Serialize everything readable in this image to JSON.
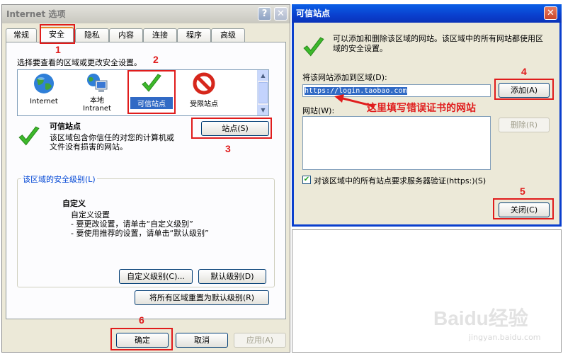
{
  "left_dialog": {
    "title": "Internet 选项",
    "tabs": [
      "常规",
      "安全",
      "隐私",
      "内容",
      "连接",
      "程序",
      "高级"
    ],
    "zone_prompt": "选择要查看的区域或更改安全设置。",
    "zones": [
      {
        "label": "Internet",
        "icon": "globe-icon"
      },
      {
        "label": "本地\nIntranet",
        "icon": "intranet-icon"
      },
      {
        "label": "可信站点",
        "icon": "checkmark-icon"
      },
      {
        "label": "受限站点",
        "icon": "no-entry-icon"
      }
    ],
    "zone_title": "可信站点",
    "zone_desc": "该区域包含你信任的对您的计算机或文件没有损害的网站。",
    "sites_button": "站点(S)",
    "security_group": "该区域的安全级别(L)",
    "custom_title": "自定义",
    "custom_lines": [
      "自定义设置",
      "- 要更改设置，请单击“自定义级别”",
      "- 要使用推荐的设置，请单击“默认级别”"
    ],
    "custom_level_button": "自定义级别(C)...",
    "default_level_button": "默认级别(D)",
    "reset_all_button": "将所有区域重置为默认级别(R)",
    "ok_button": "确定",
    "cancel_button": "取消",
    "apply_button": "应用(A)"
  },
  "right_dialog": {
    "title": "可信站点",
    "info": "可以添加和删除该区域的网站。该区域中的所有网站都使用区域的安全设置。",
    "add_label": "将该网站添加到区域(D):",
    "url_value": "https://login.taobao.com",
    "add_button": "添加(A)",
    "websites_label": "网站(W):",
    "remove_button": "删除(R)",
    "https_checkbox": "对该区域中的所有站点要求服务器验证(https:)(S)",
    "https_checked": true,
    "close_button": "关闭(C)"
  },
  "annotations": {
    "steps": [
      "1",
      "2",
      "3",
      "4",
      "5",
      "6"
    ],
    "arrow_note": "这里填写错误证书的网站",
    "color": "#e01c1c"
  },
  "watermark": {
    "brand": "Baidu经验",
    "url": "jingyan.baidu.com"
  },
  "colors": {
    "dialog_bg": "#ece9d8",
    "active_title": "#0a3fce",
    "check_green": "#3db92b"
  }
}
